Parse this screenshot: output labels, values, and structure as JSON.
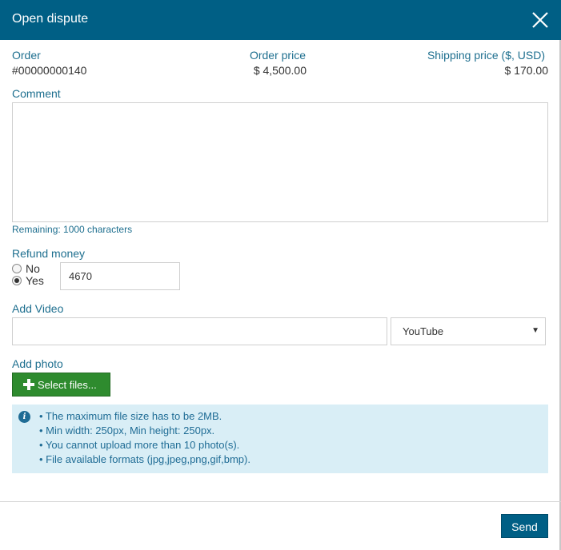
{
  "dialog": {
    "title": "Open dispute",
    "close_icon": "close-icon"
  },
  "order_info": {
    "order_label": "Order",
    "order_value": "#00000000140",
    "price_label": "Order price",
    "price_value": "$ 4,500.00",
    "shipping_label": "Shipping price ($, USD)",
    "shipping_value": "$ 170.00"
  },
  "comment": {
    "label": "Comment",
    "value": "",
    "remaining": "Remaining: 1000 characters"
  },
  "refund": {
    "label": "Refund money",
    "options": [
      {
        "label": "No",
        "selected": false
      },
      {
        "label": "Yes",
        "selected": true
      }
    ],
    "amount": "4670"
  },
  "video": {
    "label": "Add Video",
    "url_value": "",
    "provider": "YouTube",
    "caret_icon": "dropdown-caret-icon"
  },
  "photo": {
    "label": "Add photo",
    "select_button": "Select files...",
    "plus_icon": "plus-icon",
    "info_icon": "info-icon",
    "info_color": "#d9eef6",
    "rules": [
      "• The maximum file size has to be 2MB.",
      "• Min width: 250px, Min height: 250px.",
      "• You cannot upload more than 10 photo(s).",
      "• File available formats (jpg,jpeg,png,gif,bmp)."
    ]
  },
  "footer": {
    "send_button": "Send"
  },
  "colors": {
    "header": "#005f85",
    "label": "#1e6f8f",
    "select_button": "#2e8b2e"
  }
}
